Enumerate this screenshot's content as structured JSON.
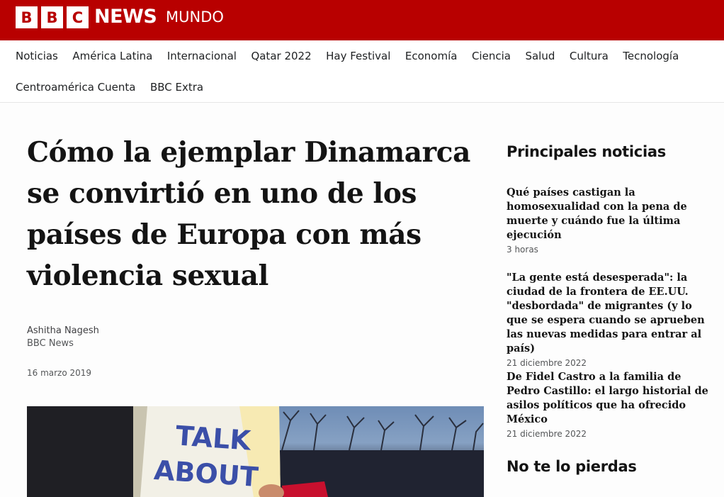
{
  "header": {
    "logo_letters": [
      "B",
      "B",
      "C"
    ],
    "brand": "NEWS",
    "edition": "MUNDO",
    "brand_color": "#b80000"
  },
  "nav": {
    "row1": [
      "Noticias",
      "América Latina",
      "Internacional",
      "Qatar 2022",
      "Hay Festival",
      "Economía",
      "Ciencia",
      "Salud",
      "Cultura",
      "Tecnología"
    ],
    "row2": [
      "Centroamérica Cuenta",
      "BBC Extra"
    ]
  },
  "article": {
    "headline_lines": [
      "Cómo la ejemplar Dinamarca",
      "se convirtió en uno de los",
      "países de Europa con más",
      "violencia sexual"
    ],
    "author": "Ashitha Nagesh",
    "outlet": "BBC News",
    "date": "16 marzo 2019",
    "image_sign_text": [
      "TALK",
      "ABOUT"
    ]
  },
  "sidebar": {
    "top_heading": "Principales noticias",
    "stories": [
      {
        "title": "Qué países castigan la homosexualidad con la pena de muerte y cuándo fue la última ejecución",
        "time": "3 horas"
      },
      {
        "title": "\"La gente está desesperada\": la ciudad de la frontera de EE.UU. \"desbordada\" de migrantes (y lo que se espera cuando se aprueben las nuevas medidas para entrar al país)",
        "time": "21 diciembre 2022"
      },
      {
        "title": "De Fidel Castro a la familia de Pedro Castillo: el largo historial de asilos políticos que ha ofrecido México",
        "time": "21 diciembre 2022"
      }
    ],
    "miss_heading": "No te lo pierdas"
  }
}
